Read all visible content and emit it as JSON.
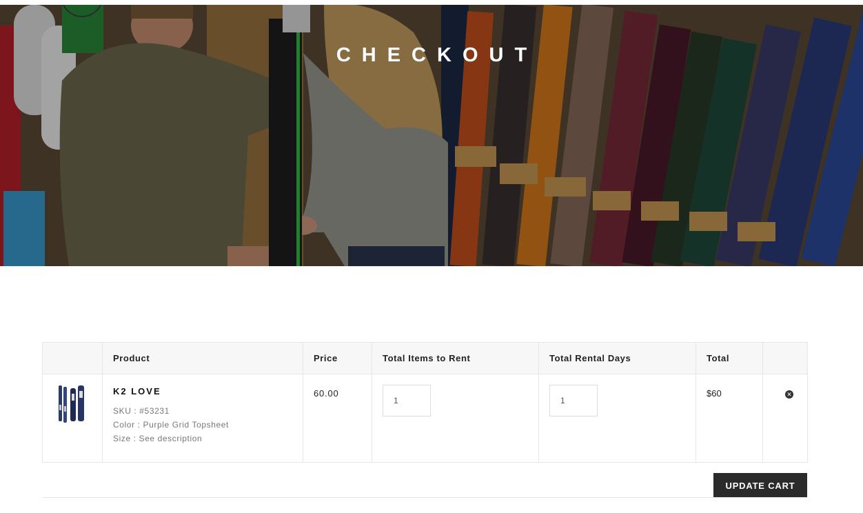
{
  "hero": {
    "title": "CHECKOUT"
  },
  "cart": {
    "headers": {
      "image": "",
      "product": "Product",
      "price": "Price",
      "items": "Total Items to Rent",
      "days": "Total Rental Days",
      "total": "Total",
      "remove": ""
    },
    "rows": [
      {
        "name": "K2 LOVE",
        "sku": "SKU : #53231",
        "color": "Color : Purple Grid Topsheet",
        "size": "Size : See description",
        "price": "60.00",
        "items_to_rent": "1",
        "rental_days": "1",
        "total": "$60"
      }
    ]
  },
  "actions": {
    "update_cart": "UPDATE CART"
  },
  "icons": {
    "remove": "remove-circle-x-icon",
    "logo": "logo-badge-icon"
  },
  "colors": {
    "button": "#2b2b2b",
    "header_bg": "#f7f7f7",
    "border": "#e6e6e6"
  }
}
